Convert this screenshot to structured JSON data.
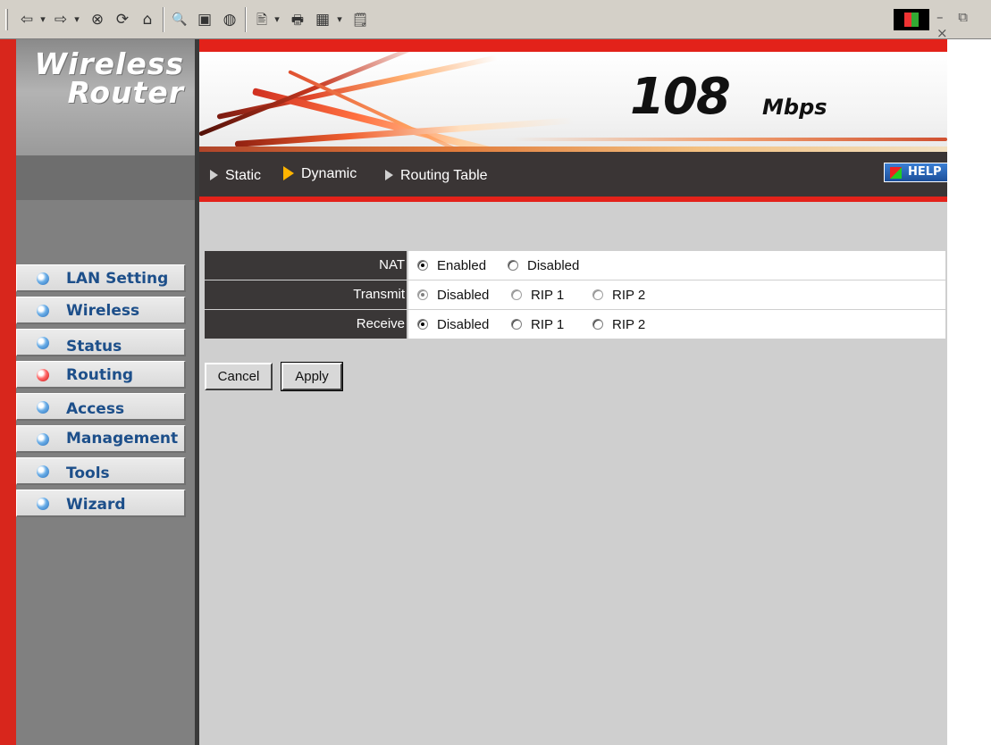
{
  "browser_toolbar": {
    "buttons": [
      "⇦",
      "▾",
      "⇨",
      "▾",
      "⊗",
      "⟳",
      "⌂",
      "🔍",
      "▣",
      "◍",
      "🖹",
      "▾",
      "🖶",
      "▦",
      "▾",
      "🗒"
    ],
    "window_controls": "– ⧉ ×"
  },
  "brand": {
    "line1": "Wireless",
    "line2": "Router"
  },
  "banner": {
    "speed": "108",
    "unit": "Mbps"
  },
  "subnav": {
    "items": [
      {
        "label": "Static",
        "active": false
      },
      {
        "label": "Dynamic",
        "active": true
      },
      {
        "label": "Routing Table",
        "active": false
      }
    ],
    "help_label": "HELP"
  },
  "sidebar": {
    "items": [
      {
        "label": "LAN Setting",
        "active": false
      },
      {
        "label": "Wireless",
        "active": false
      },
      {
        "label": "Status",
        "active": false
      },
      {
        "label": "Routing",
        "active": true
      },
      {
        "label": "Access",
        "active": false
      },
      {
        "label": "Management",
        "active": false
      },
      {
        "label": "Tools",
        "active": false
      },
      {
        "label": "Wizard",
        "active": false
      }
    ]
  },
  "form": {
    "nat": {
      "label": "NAT",
      "options": [
        "Enabled",
        "Disabled"
      ],
      "selected": "Enabled"
    },
    "transmit": {
      "label": "Transmit",
      "options": [
        "Disabled",
        "RIP 1",
        "RIP 2"
      ],
      "selected": "Disabled",
      "disabled": true
    },
    "receive": {
      "label": "Receive",
      "options": [
        "Disabled",
        "RIP 1",
        "RIP 2"
      ],
      "selected": "Disabled"
    }
  },
  "buttons": {
    "cancel": "Cancel",
    "apply": "Apply"
  },
  "colors": {
    "accent_red": "#e3221a",
    "dark_bar": "#3a3535",
    "menu_text": "#1d4f8a",
    "content_bg": "#cfcfcf"
  }
}
